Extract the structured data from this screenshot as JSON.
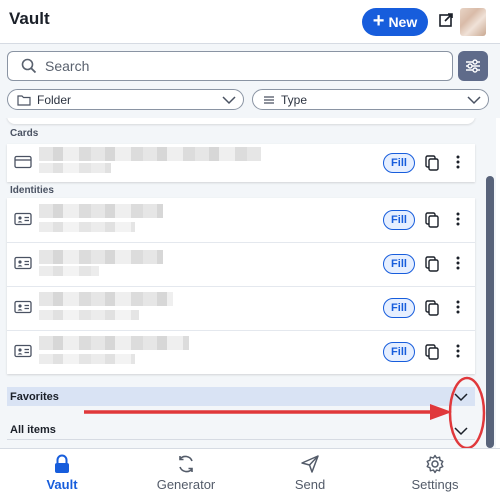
{
  "header": {
    "title": "Vault",
    "new_label": "New"
  },
  "search": {
    "placeholder": "Search"
  },
  "filters": {
    "folder_label": "Folder",
    "type_label": "Type"
  },
  "list": {
    "sections": [
      {
        "label": "Cards",
        "items": [
          {
            "type_icon": "credit-card-icon",
            "fill_label": "Fill"
          }
        ]
      },
      {
        "label": "Identities",
        "items": [
          {
            "type_icon": "id-card-icon",
            "fill_label": "Fill"
          },
          {
            "type_icon": "id-card-icon",
            "fill_label": "Fill"
          },
          {
            "type_icon": "id-card-icon",
            "fill_label": "Fill"
          },
          {
            "type_icon": "id-card-icon",
            "fill_label": "Fill"
          }
        ]
      }
    ],
    "groups": [
      {
        "label": "Favorites",
        "expanded": false
      },
      {
        "label": "All items",
        "expanded": false
      }
    ]
  },
  "nav": {
    "items": [
      {
        "label": "Vault",
        "icon": "lock-icon",
        "active": true
      },
      {
        "label": "Generator",
        "icon": "generate-icon",
        "active": false
      },
      {
        "label": "Send",
        "icon": "send-icon",
        "active": false
      },
      {
        "label": "Settings",
        "icon": "gear-icon",
        "active": false
      }
    ]
  },
  "colors": {
    "primary": "#175ddc",
    "annotation": "#e0383b",
    "favorites_highlight": "#d9e3f4"
  }
}
